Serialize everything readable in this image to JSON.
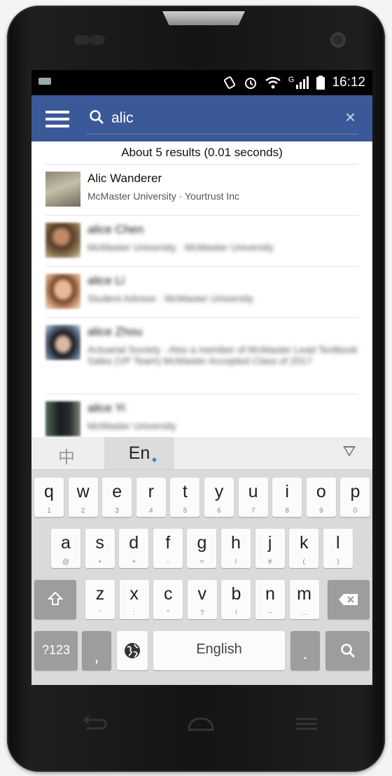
{
  "status_bar": {
    "time": "16:12",
    "network": "G"
  },
  "app_bar": {
    "search_value": "alic",
    "clear_glyph": "×"
  },
  "results": {
    "count_text": "About 5 results (0.01 seconds)",
    "items": [
      {
        "name": "Alic Wanderer",
        "subtitle": "McMaster University · Yourtrust Inc",
        "blurred": false
      },
      {
        "name": "alice Chen",
        "subtitle": "McMaster University · McMaster University",
        "blurred": true
      },
      {
        "name": "alice Li",
        "subtitle": "Student Advisor · McMaster University",
        "blurred": true
      },
      {
        "name": "alice Zhou",
        "subtitle": "Actuarial Society · Also a member of McMaster Lead Textbook Sales (VP Team) McMaster Accepted Class of 2017",
        "blurred": true
      },
      {
        "name": "alice Yi",
        "subtitle": "McMaster University",
        "blurred": true
      }
    ]
  },
  "keyboard": {
    "lang_zh": "中",
    "lang_en": "En",
    "row1": [
      {
        "k": "q",
        "s": "1"
      },
      {
        "k": "w",
        "s": "2"
      },
      {
        "k": "e",
        "s": "3"
      },
      {
        "k": "r",
        "s": "4"
      },
      {
        "k": "t",
        "s": "5"
      },
      {
        "k": "y",
        "s": "6"
      },
      {
        "k": "u",
        "s": "7"
      },
      {
        "k": "i",
        "s": "8"
      },
      {
        "k": "o",
        "s": "9"
      },
      {
        "k": "p",
        "s": "0"
      }
    ],
    "row2": [
      {
        "k": "a",
        "s": "@"
      },
      {
        "k": "s",
        "s": "•"
      },
      {
        "k": "d",
        "s": "+"
      },
      {
        "k": "f",
        "s": "-"
      },
      {
        "k": "g",
        "s": "="
      },
      {
        "k": "h",
        "s": "/"
      },
      {
        "k": "j",
        "s": "#"
      },
      {
        "k": "k",
        "s": "("
      },
      {
        "k": "l",
        "s": ")"
      }
    ],
    "row3": [
      {
        "k": "z",
        "s": "'"
      },
      {
        "k": "x",
        "s": ":"
      },
      {
        "k": "c",
        "s": "\""
      },
      {
        "k": "v",
        "s": "?"
      },
      {
        "k": "b",
        "s": "!"
      },
      {
        "k": "n",
        "s": "~"
      },
      {
        "k": "m",
        "s": "…"
      }
    ],
    "symbols_label": "?123",
    "comma_label": ",",
    "space_label": "English",
    "period_label": "."
  },
  "colors": {
    "app_bar": "#3b5998",
    "accent": "#2d8cd6"
  },
  "icons": [
    "menu-icon",
    "search-icon",
    "clear-icon",
    "globe-icon",
    "shift-icon",
    "backspace-icon",
    "search-key-icon",
    "back-icon",
    "home-icon",
    "recents-icon"
  ]
}
